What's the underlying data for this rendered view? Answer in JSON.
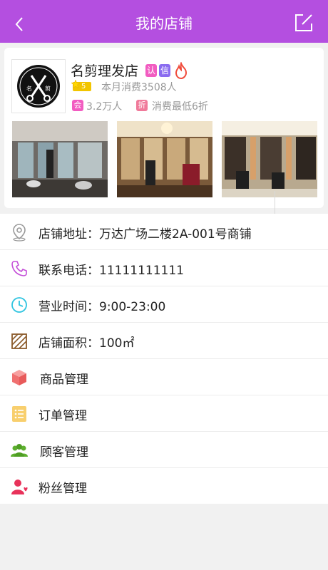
{
  "header": {
    "title": "我的店铺",
    "back_icon": "chevron-left-icon",
    "edit_icon": "edit-icon"
  },
  "shop": {
    "name": "名剪理发店",
    "logo_text_left": "名",
    "logo_text_right": "剪",
    "badge_cert": "认",
    "badge_trust": "信",
    "rating": "5",
    "monthly_consumption": "本月消费3508人",
    "member_tag": "会",
    "member_count": "3.2万人",
    "discount_tag": "折",
    "discount_text": "消费最低6折",
    "colors": {
      "cert": "#f25cc1",
      "trust": "#8a6cf0",
      "member": "#f25cc1",
      "discount": "#f07a9a"
    }
  },
  "info": {
    "address_label": "店铺地址：",
    "address_value": "万达广场二楼2A-001号商铺",
    "phone_label": "联系电话：",
    "phone_value": "11111111111",
    "hours_label": "营业时间：",
    "hours_value": "9:00-23:00",
    "area_label": "店铺面积：",
    "area_value": "100㎡"
  },
  "menu": {
    "products": "商品管理",
    "orders": "订单管理",
    "customers": "顾客管理",
    "fans": "粉丝管理"
  },
  "accent": "#b44fe0"
}
